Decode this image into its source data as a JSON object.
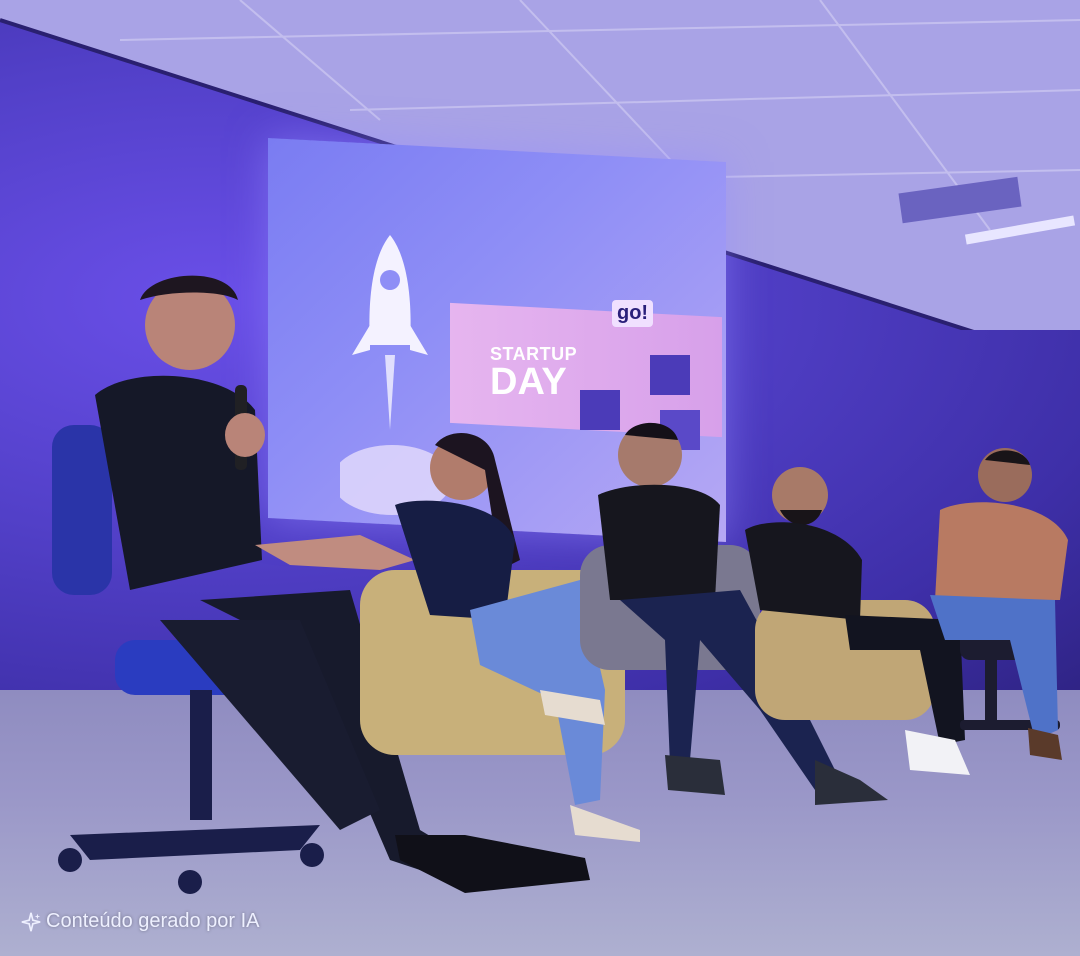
{
  "screen": {
    "slide_line1": "STARTUP",
    "slide_line2": "DAY",
    "logo_text": "go!"
  },
  "watermark": {
    "text": "Conteúdo gerado por IA",
    "icon": "sparkle-icon"
  },
  "colors": {
    "stage_light": "#5b4fd0",
    "screen": "#8e8ef6",
    "banner": "#e6b5ef"
  }
}
